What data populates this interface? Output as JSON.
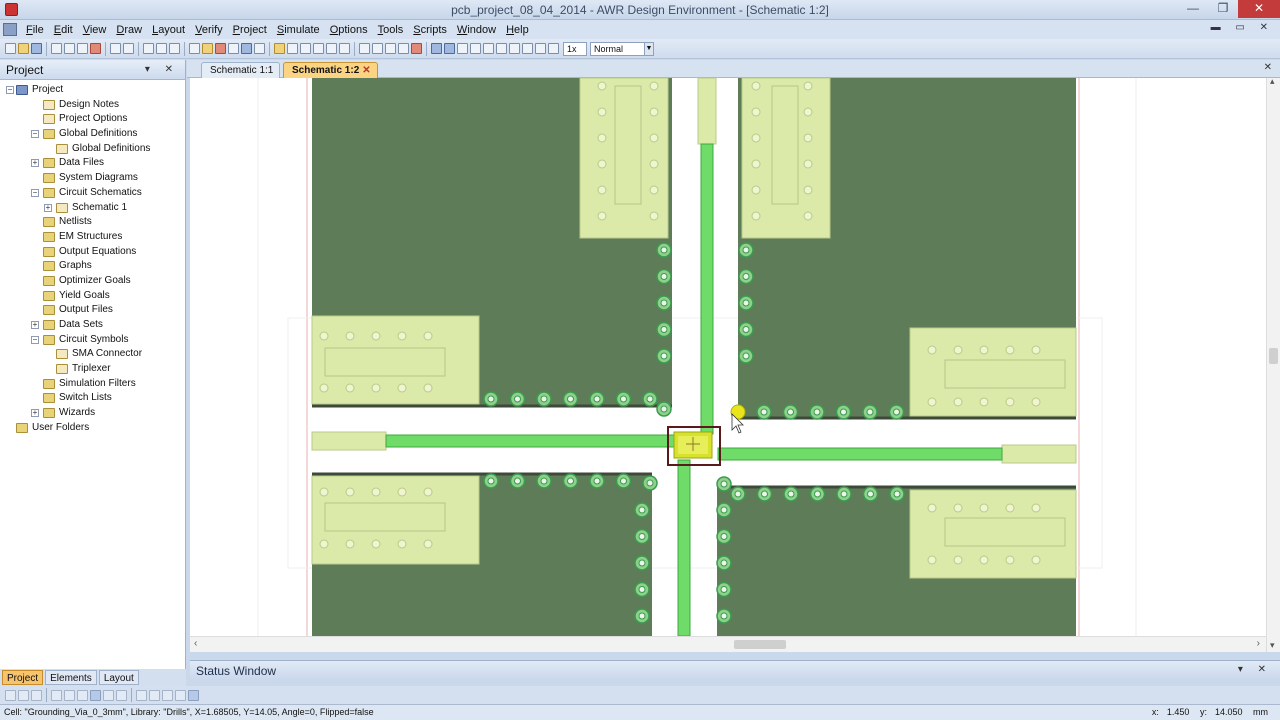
{
  "window": {
    "title": "pcb_project_08_04_2014 - AWR Design Environment - [Schematic 1:2]",
    "minimize": "—",
    "restore": "❐",
    "close": "✕"
  },
  "menubar": {
    "items": [
      "File",
      "Edit",
      "View",
      "Draw",
      "Layout",
      "Verify",
      "Project",
      "Simulate",
      "Options",
      "Tools",
      "Scripts",
      "Window",
      "Help"
    ],
    "mdi_controls": "▬ ▭ ✕"
  },
  "toolbar": {
    "zoom_value": "1x",
    "mode_value": "Normal",
    "arrow": "▼"
  },
  "project_panel": {
    "title": "Project",
    "pin": "▾ ✕",
    "tree": [
      {
        "label": "Project",
        "level": 0,
        "expander": "−",
        "icon": "proj"
      },
      {
        "label": "Design Notes",
        "level": 1,
        "expander": "",
        "icon": "doc"
      },
      {
        "label": "Project Options",
        "level": 1,
        "expander": "",
        "icon": "doc"
      },
      {
        "label": "Global Definitions",
        "level": 1,
        "expander": "−",
        "icon": "folder"
      },
      {
        "label": "Global Definitions",
        "level": 2,
        "expander": "",
        "icon": "doc"
      },
      {
        "label": "Data Files",
        "level": 1,
        "expander": "+",
        "icon": "folder"
      },
      {
        "label": "System Diagrams",
        "level": 1,
        "expander": "",
        "icon": "folder"
      },
      {
        "label": "Circuit Schematics",
        "level": 1,
        "expander": "−",
        "icon": "folder"
      },
      {
        "label": "Schematic 1",
        "level": 2,
        "expander": "+",
        "icon": "doc"
      },
      {
        "label": "Netlists",
        "level": 1,
        "expander": "",
        "icon": "folder"
      },
      {
        "label": "EM Structures",
        "level": 1,
        "expander": "",
        "icon": "folder"
      },
      {
        "label": "Output Equations",
        "level": 1,
        "expander": "",
        "icon": "folder"
      },
      {
        "label": "Graphs",
        "level": 1,
        "expander": "",
        "icon": "folder"
      },
      {
        "label": "Optimizer Goals",
        "level": 1,
        "expander": "",
        "icon": "folder"
      },
      {
        "label": "Yield Goals",
        "level": 1,
        "expander": "",
        "icon": "folder"
      },
      {
        "label": "Output Files",
        "level": 1,
        "expander": "",
        "icon": "folder"
      },
      {
        "label": "Data Sets",
        "level": 1,
        "expander": "+",
        "icon": "folder"
      },
      {
        "label": "Circuit Symbols",
        "level": 1,
        "expander": "−",
        "icon": "folder"
      },
      {
        "label": "SMA Connector",
        "level": 2,
        "expander": "",
        "icon": "doc"
      },
      {
        "label": "Triplexer",
        "level": 2,
        "expander": "",
        "icon": "doc"
      },
      {
        "label": "Simulation Filters",
        "level": 1,
        "expander": "",
        "icon": "folder"
      },
      {
        "label": "Switch Lists",
        "level": 1,
        "expander": "",
        "icon": "folder"
      },
      {
        "label": "Wizards",
        "level": 1,
        "expander": "+",
        "icon": "folder"
      },
      {
        "label": "User Folders",
        "level": 0,
        "expander": "",
        "icon": "folder"
      }
    ],
    "tabs": [
      "Project",
      "Elements",
      "Layout"
    ]
  },
  "doc_tabs": {
    "tabs": [
      "Schematic 1:1",
      "Schematic 1:2"
    ],
    "active": 1,
    "close_glyph": "✕",
    "panel_close": "✕"
  },
  "status_window": {
    "title": "Status Window",
    "controls": "▾ ✕"
  },
  "statusbar": {
    "text": "Cell: \"Grounding_Via_0_3mm\", Library: \"Drills\", X=1.68505, Y=14.05, Angle=0, Flipped=false",
    "x_label": "x:",
    "x_value": "1.450",
    "y_label": "y:",
    "y_value": "14.050",
    "unit": "mm"
  },
  "scrollbars": {
    "left_arrow": "‹",
    "right_arrow": "›",
    "up_arrow": "▴",
    "down_arrow": "▾"
  },
  "layout_colors": {
    "board_background": "#5f7c59",
    "board_edge": "#d9a0a0",
    "pad_fill": "#dbeaa8",
    "trace_green": "#6fdc6a",
    "via_ring": "#3a9a4f",
    "selection_box": "#5b1a1a",
    "selected_component": "#d8e22a"
  }
}
